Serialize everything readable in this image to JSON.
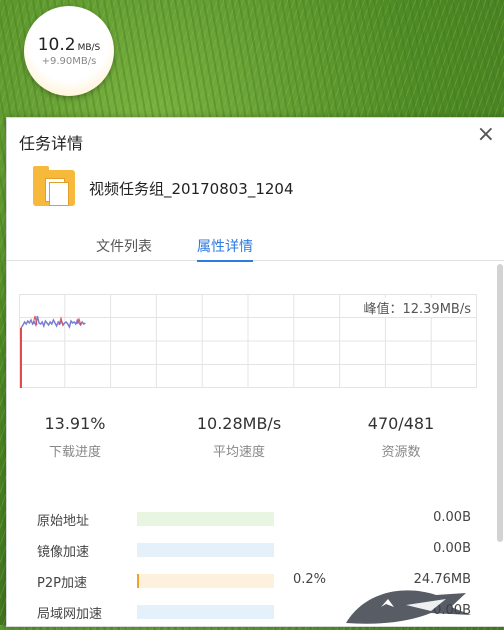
{
  "speed_ball": {
    "speed": "10.2",
    "unit": "MB/S",
    "delta": "+9.90MB/s"
  },
  "panel": {
    "title": "任务详情",
    "close": "×",
    "task_name": "视频任务组_20170803_1204",
    "tabs": [
      {
        "label": "文件列表"
      },
      {
        "label": "属性详情"
      }
    ],
    "active_tab": "属性详情"
  },
  "chart": {
    "peak_text": "峰值：12.39MB/s",
    "grid_columns": 10,
    "grid_rows": 4,
    "line_color": "#7b7fd1",
    "spike_color": "#e04b4b"
  },
  "stats": [
    {
      "value": "13.91%",
      "label": "下载进度"
    },
    {
      "value": "10.28MB/s",
      "label": "平均速度"
    },
    {
      "value": "470/481",
      "label": "资源数"
    }
  ],
  "rows": [
    {
      "name": "原始地址",
      "pct": "",
      "size": "0.00B",
      "color": "#e8f5e0",
      "fill": 0
    },
    {
      "name": "镜像加速",
      "pct": "",
      "size": "0.00B",
      "color": "#e4f1fb",
      "fill": 0
    },
    {
      "name": "P2P加速",
      "pct": "0.2%",
      "size": "24.76MB",
      "color": "#fdf0dc",
      "fill": 0.002
    },
    {
      "name": "局域网加速",
      "pct": "",
      "size": "0.00B",
      "color": "#e4f1fb",
      "fill": 0
    }
  ],
  "colors": {
    "accent": "#2d7be0",
    "folder": "#f6b93b",
    "p2p_fill": "#f0a030"
  }
}
